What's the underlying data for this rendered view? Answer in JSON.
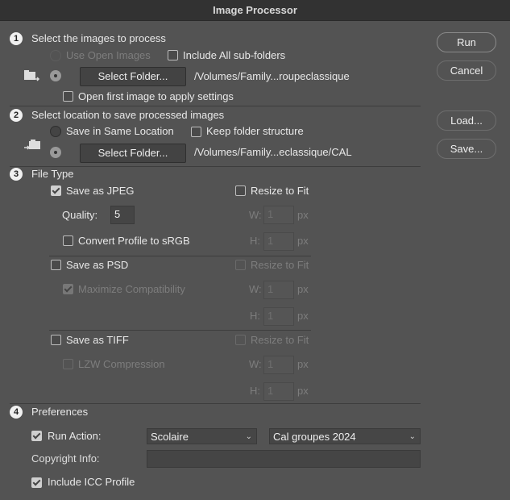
{
  "window": {
    "title": "Image Processor"
  },
  "buttons": {
    "run": "Run",
    "cancel": "Cancel",
    "load": "Load...",
    "save": "Save..."
  },
  "step1": {
    "num": "1",
    "label": "Select the images to process",
    "use_open": "Use Open Images",
    "include_sub": "Include All sub-folders",
    "select_folder": "Select Folder...",
    "path": "/Volumes/Family...roupeclassique",
    "open_first": "Open first image to apply settings"
  },
  "step2": {
    "num": "2",
    "label": "Select location to save processed images",
    "same_location": "Save in Same Location",
    "keep_structure": "Keep folder structure",
    "select_folder": "Select Folder...",
    "path": "/Volumes/Family...eclassique/CAL"
  },
  "step3": {
    "num": "3",
    "label": "File Type",
    "jpeg": "Save as JPEG",
    "quality_label": "Quality:",
    "quality": "5",
    "convert": "Convert Profile to sRGB",
    "psd": "Save as PSD",
    "maximize": "Maximize Compatibility",
    "tiff": "Save as TIFF",
    "lzw": "LZW Compression",
    "resize": "Resize to Fit",
    "w": "W:",
    "h": "H:",
    "px": "px",
    "dim": "1"
  },
  "step4": {
    "num": "4",
    "label": "Preferences",
    "run_action": "Run Action:",
    "action_set": "Scolaire",
    "action": "Cal groupes 2024",
    "copyright": "Copyright Info:",
    "copyright_value": "",
    "icc": "Include ICC Profile"
  }
}
